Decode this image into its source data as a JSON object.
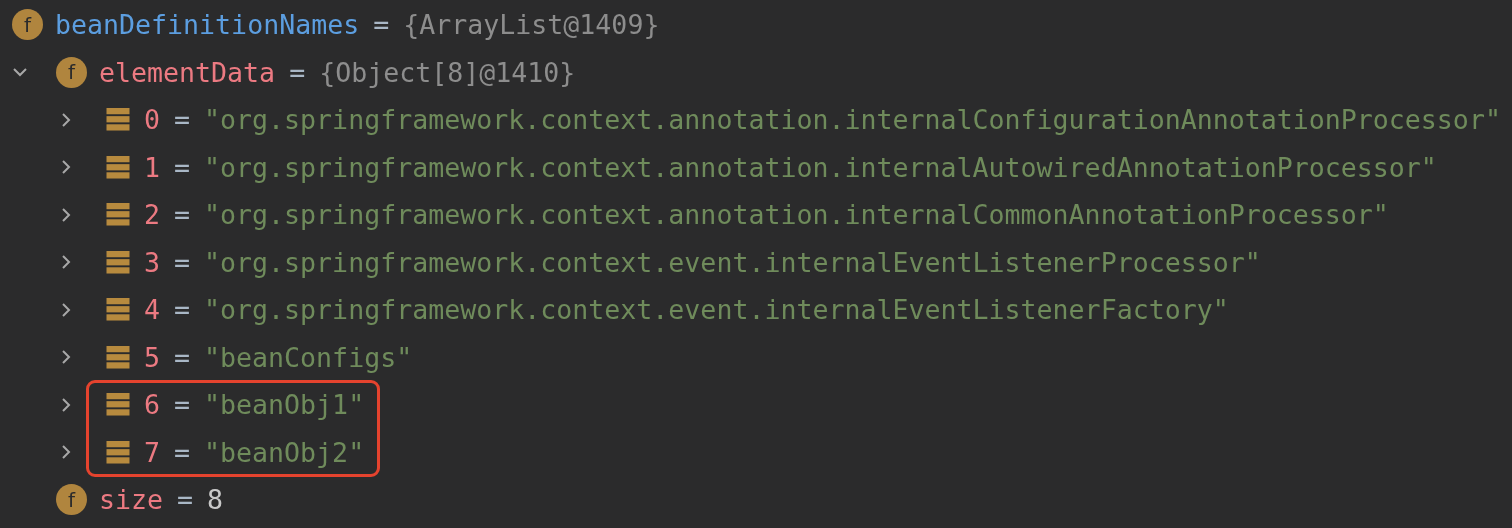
{
  "variables": [
    {
      "kind": "field",
      "badge": "f",
      "name": "beanDefinitionNames",
      "color": "#5c9ee0",
      "operator": "=",
      "value": {
        "text": "{ArrayList@1409}",
        "color": "#8d8d8d"
      },
      "children": [
        {
          "kind": "field",
          "badge": "f",
          "name": "elementData",
          "color": "#ec7a82",
          "operator": "=",
          "value": {
            "text": "{Object[8]@1410}",
            "color": "#8d8d8d"
          },
          "expanded": true,
          "children": [
            {
              "kind": "element",
              "name": "0",
              "color": "#ec7a82",
              "operator": "=",
              "value": {
                "text": "\"org.springframework.context.annotation.internalConfigurationAnnotationProcessor\"",
                "color": "#6f8b5b"
              },
              "expanded": false,
              "highlighted": false
            },
            {
              "kind": "element",
              "name": "1",
              "color": "#ec7a82",
              "operator": "=",
              "value": {
                "text": "\"org.springframework.context.annotation.internalAutowiredAnnotationProcessor\"",
                "color": "#6f8b5b"
              },
              "expanded": false,
              "highlighted": false
            },
            {
              "kind": "element",
              "name": "2",
              "color": "#ec7a82",
              "operator": "=",
              "value": {
                "text": "\"org.springframework.context.annotation.internalCommonAnnotationProcessor\"",
                "color": "#6f8b5b"
              },
              "expanded": false,
              "highlighted": false
            },
            {
              "kind": "element",
              "name": "3",
              "color": "#ec7a82",
              "operator": "=",
              "value": {
                "text": "\"org.springframework.context.event.internalEventListenerProcessor\"",
                "color": "#6f8b5b"
              },
              "expanded": false,
              "highlighted": false
            },
            {
              "kind": "element",
              "name": "4",
              "color": "#ec7a82",
              "operator": "=",
              "value": {
                "text": "\"org.springframework.context.event.internalEventListenerFactory\"",
                "color": "#6f8b5b"
              },
              "expanded": false,
              "highlighted": false
            },
            {
              "kind": "element",
              "name": "5",
              "color": "#ec7a82",
              "operator": "=",
              "value": {
                "text": "\"beanConfigs\"",
                "color": "#6f8b5b"
              },
              "expanded": false,
              "highlighted": false
            },
            {
              "kind": "element",
              "name": "6",
              "color": "#ec7a82",
              "operator": "=",
              "value": {
                "text": "\"beanObj1\"",
                "color": "#6f8b5b"
              },
              "expanded": false,
              "highlighted": true
            },
            {
              "kind": "element",
              "name": "7",
              "color": "#ec7a82",
              "operator": "=",
              "value": {
                "text": "\"beanObj2\"",
                "color": "#6f8b5b"
              },
              "expanded": false,
              "highlighted": true
            }
          ]
        },
        {
          "kind": "field",
          "badge": "f",
          "name": "size",
          "color": "#ec7a82",
          "operator": "=",
          "value": {
            "text": "8",
            "color": "#c8c8c8"
          }
        }
      ]
    }
  ]
}
